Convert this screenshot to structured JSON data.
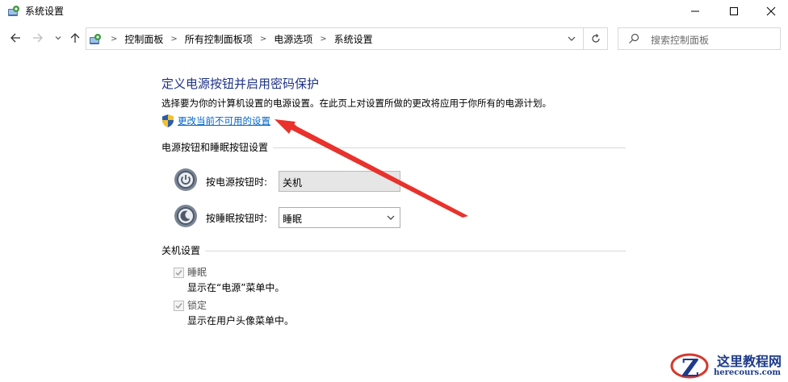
{
  "window": {
    "title": "系统设置",
    "controls": {
      "minimize": "minimize",
      "maximize": "maximize",
      "close": "close"
    }
  },
  "nav": {
    "back_icon": "arrow-left-icon",
    "forward_icon": "arrow-right-icon",
    "recent_icon": "chevron-down-icon",
    "up_icon": "arrow-up-icon"
  },
  "address": {
    "crumbs": [
      "控制面板",
      "所有控制面板项",
      "电源选项",
      "系统设置"
    ]
  },
  "search": {
    "placeholder": "搜索控制面板"
  },
  "main": {
    "title": "定义电源按钮并启用密码保护",
    "description": "选择要为你的计算机设置的电源设置。在此页上对设置所做的更改将应用于你所有的电源计划。",
    "change_link": "更改当前不可用的设置",
    "power_section": {
      "title": "电源按钮和睡眠按钮设置",
      "power_label": "按电源按钮时:",
      "power_value": "关机",
      "sleep_label": "按睡眠按钮时:",
      "sleep_value": "睡眠"
    },
    "shutdown_section": {
      "title": "关机设置",
      "options": [
        {
          "label": "睡眠",
          "description": "显示在“电源”菜单中。",
          "checked": true
        },
        {
          "label": "锁定",
          "description": "显示在用户头像菜单中。",
          "checked": true
        }
      ]
    }
  },
  "watermark": {
    "text": "这里教程网",
    "url": "herecours.com"
  },
  "colors": {
    "title": "#1e3287",
    "link": "#0066cc",
    "arrow": "#e8322b"
  }
}
